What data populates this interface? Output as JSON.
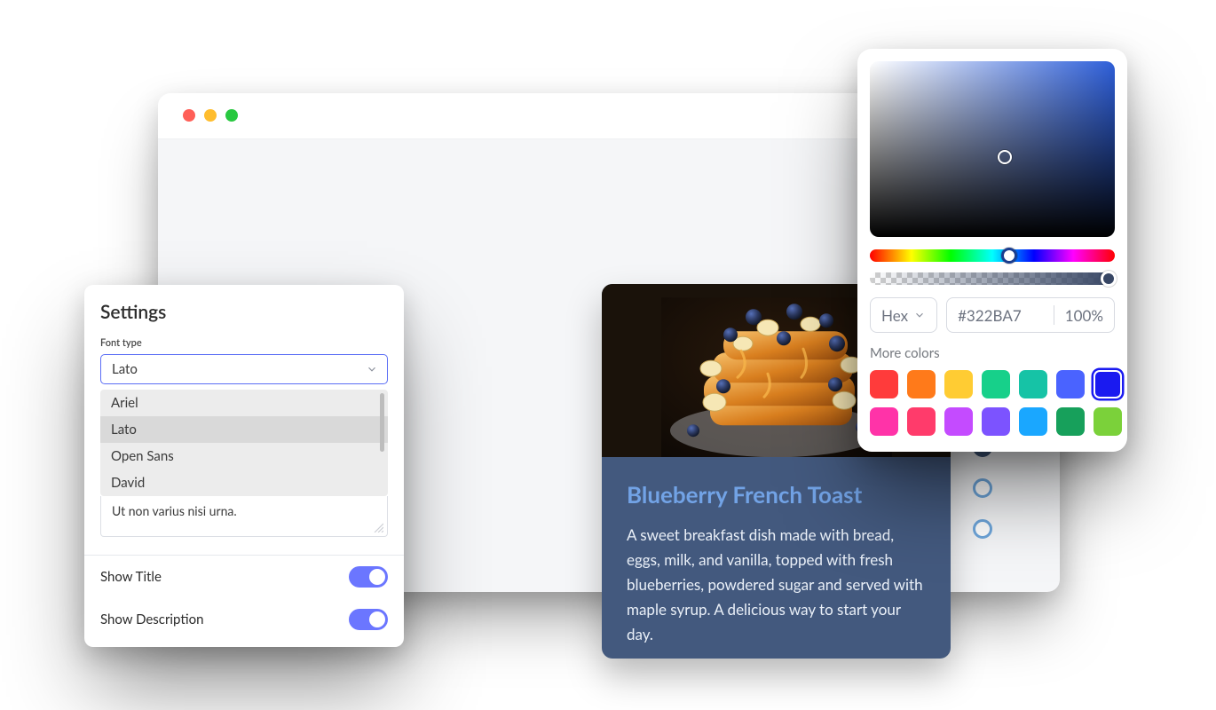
{
  "settings": {
    "title": "Settings",
    "font_label": "Font type",
    "font_selected": "Lato",
    "font_options": [
      "Ariel",
      "Lato",
      "Open Sans",
      "David"
    ],
    "textarea": "Ut non varius nisi urna.",
    "show_title_label": "Show Title",
    "show_title": true,
    "show_desc_label": "Show Description",
    "show_desc": true
  },
  "card": {
    "title": "Blueberry French Toast",
    "description": "A sweet breakfast dish made with bread, eggs, milk, and vanilla, topped with fresh blueberries, powdered sugar and served with maple syrup. A delicious way to start your day."
  },
  "indicators": {
    "count": 4,
    "active": 1
  },
  "picker": {
    "format": "Hex",
    "hex": "#322BA7",
    "opacity": "100%",
    "more_label": "More colors",
    "swatches": [
      "#ff3b3b",
      "#ff7a1a",
      "#ffcc33",
      "#17d08a",
      "#16c3a6",
      "#4a63ff",
      "#1a1af0",
      "#ff33a8",
      "#ff3b6b",
      "#c44bff",
      "#7c53ff",
      "#1aa7ff",
      "#17a05b",
      "#7bd13a"
    ],
    "swatch_selected": 6
  }
}
